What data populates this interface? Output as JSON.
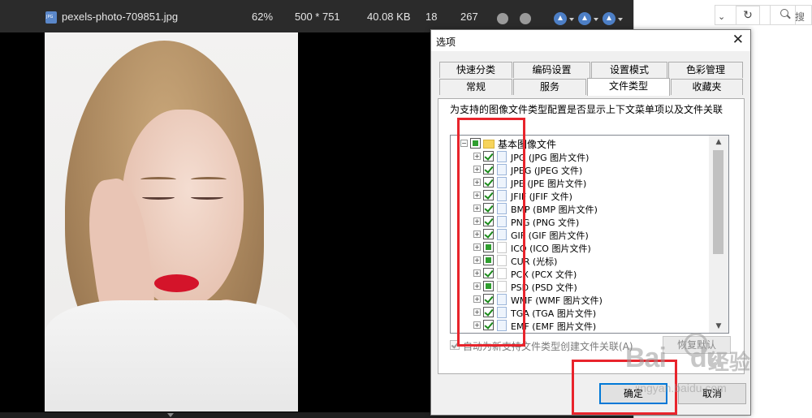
{
  "viewer": {
    "filename": "pexels-photo-709851.jpg",
    "zoom": "62%",
    "dimensions": "500 * 751",
    "filesize": "40.08 KB",
    "index": "18",
    "total": "267",
    "bar_color": "#2b2b2b"
  },
  "explorer": {
    "search_label": "搜"
  },
  "dialog": {
    "title": "选项",
    "tabs_row1": [
      "快速分类",
      "编码设置",
      "设置模式",
      "色彩管理"
    ],
    "tabs_row2": [
      "常规",
      "服务",
      "文件类型",
      "收藏夹"
    ],
    "active_tab": "文件类型",
    "description": "为支持的图像文件类型配置是否显示上下文菜单项以及文件关联",
    "tree": {
      "root": {
        "label": "基本图像文件",
        "state": "partial"
      },
      "items": [
        {
          "label": "JPG (JPG 图片文件)",
          "checked": true,
          "icon": "jpg-icon"
        },
        {
          "label": "JPEG (JPEG 文件)",
          "checked": true,
          "icon": "jpg-icon"
        },
        {
          "label": "JPE (JPE 图片文件)",
          "checked": true,
          "icon": "jpg-icon"
        },
        {
          "label": "JFIF (JFIF 文件)",
          "checked": true,
          "icon": "jpg-icon"
        },
        {
          "label": "BMP (BMP 图片文件)",
          "checked": true,
          "icon": "bmp-icon"
        },
        {
          "label": "PNG (PNG 文件)",
          "checked": true,
          "icon": "png-icon"
        },
        {
          "label": "GIF (GIF 图片文件)",
          "checked": true,
          "icon": "gif-icon"
        },
        {
          "label": "ICO (ICO 图片文件)",
          "checked": false,
          "partial": true,
          "icon": "blank-file-icon"
        },
        {
          "label": "CUR (光标)",
          "checked": false,
          "partial": true,
          "icon": "blank-file-icon"
        },
        {
          "label": "PCX (PCX 文件)",
          "checked": true,
          "icon": "blank-file-icon"
        },
        {
          "label": "PSD (PSD 文件)",
          "checked": false,
          "partial": true,
          "icon": "blank-file-icon"
        },
        {
          "label": "WMF (WMF 图片文件)",
          "checked": true,
          "icon": "wmf-icon"
        },
        {
          "label": "TGA (TGA 图片文件)",
          "checked": true,
          "icon": "tga-icon"
        },
        {
          "label": "EMF (EMF 图片文件)",
          "checked": true,
          "icon": "emf-icon"
        }
      ]
    },
    "auto_assoc_label": "自动为新支持文件类型创建文件关联(A)",
    "restore_label": "恢复默认",
    "ok_label": "确定",
    "cancel_label": "取消"
  },
  "watermark": {
    "logo": "Bai",
    "logo_suffix": "du",
    "logo_cn": "经验",
    "url": "jingyan.baidu.com"
  },
  "highlight_color": "#e8242c"
}
